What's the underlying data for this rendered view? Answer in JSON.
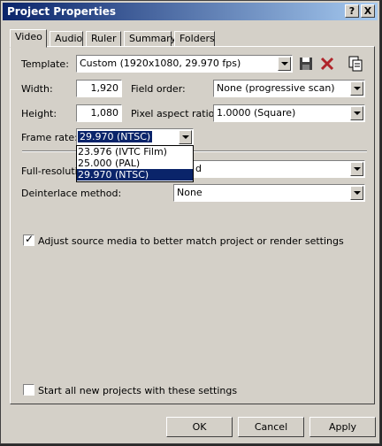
{
  "window": {
    "title": "Project Properties",
    "help_btn": "?",
    "close_btn": "X"
  },
  "tabs": [
    {
      "label": "Video",
      "active": true
    },
    {
      "label": "Audio"
    },
    {
      "label": "Ruler"
    },
    {
      "label": "Summary"
    },
    {
      "label": "Folders"
    }
  ],
  "video": {
    "template_label": "Template:",
    "template_value": "Custom (1920x1080, 29.970 fps)",
    "width_label": "Width:",
    "width_value": "1,920",
    "height_label": "Height:",
    "height_value": "1,080",
    "field_order_label": "Field order:",
    "field_order_value": "None (progressive scan)",
    "pixel_aspect_label": "Pixel aspect ratio:",
    "pixel_aspect_value": "1.0000 (Square)",
    "frame_rate_label": "Frame rate:",
    "frame_rate_value": "29.970 (NTSC)",
    "frame_rate_options": [
      "23.976 (IVTC Film)",
      "25.000 (PAL)",
      "29.970 (NTSC)"
    ],
    "full_res_label": "Full-resolutio",
    "full_res_value_partial": "d",
    "deinterlace_label": "Deinterlace method:",
    "deinterlace_value": "None",
    "adjust_source_label": "Adjust source media to better match project or render settings",
    "adjust_source_checked": true,
    "start_all_label": "Start all new projects with these settings",
    "start_all_checked": false
  },
  "buttons": {
    "ok": "OK",
    "cancel": "Cancel",
    "apply": "Apply"
  },
  "colors": {
    "title_start": "#0a246a",
    "title_end": "#a6caf0",
    "selection": "#0a246a",
    "face": "#d4d0c8"
  },
  "icons": [
    "save-icon",
    "delete-icon",
    "copy-settings-icon"
  ]
}
